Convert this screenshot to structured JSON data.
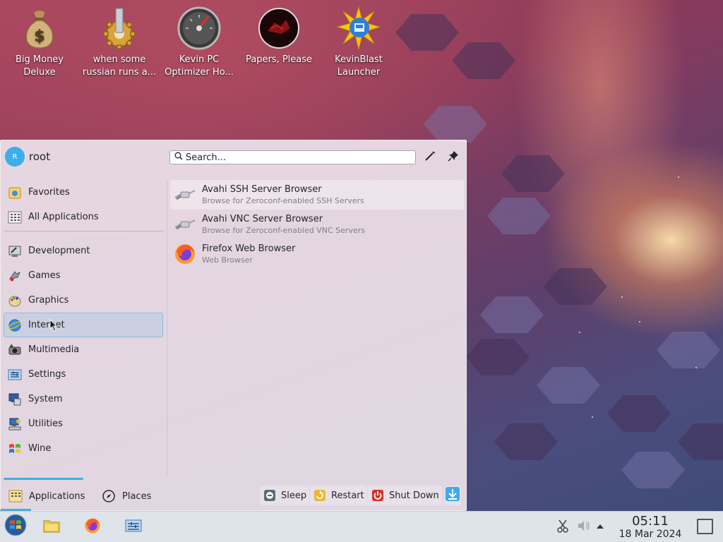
{
  "desktop": {
    "icons": [
      {
        "label": "Big Money Deluxe",
        "line1": "Big Money",
        "line2": "Deluxe",
        "icon": "money-bag-icon"
      },
      {
        "label": "when some russian runs a...",
        "line1": "when some",
        "line2": "russian runs a...",
        "icon": "gear-icon"
      },
      {
        "label": "Kevin PC Optimizer Ho...",
        "line1": "Kevin PC",
        "line2": "Optimizer Ho...",
        "icon": "speedometer-icon"
      },
      {
        "label": "Papers, Please",
        "line1": "Papers, Please",
        "line2": "",
        "icon": "papers-please-icon"
      },
      {
        "label": "KevinBlast Launcher",
        "line1": "KevinBlast",
        "line2": "Launcher",
        "icon": "kevinblast-icon"
      }
    ]
  },
  "launcher": {
    "user": {
      "initial": "R",
      "name": "root"
    },
    "search": {
      "placeholder": "Search..."
    },
    "sidebar": {
      "top": [
        {
          "label": "Favorites",
          "icon": "favorites-icon"
        },
        {
          "label": "All Applications",
          "icon": "all-apps-icon"
        }
      ],
      "categories": [
        {
          "label": "Development",
          "icon": "development-icon"
        },
        {
          "label": "Games",
          "icon": "games-icon"
        },
        {
          "label": "Graphics",
          "icon": "graphics-icon"
        },
        {
          "label": "Internet",
          "icon": "internet-icon",
          "selected": true
        },
        {
          "label": "Multimedia",
          "icon": "multimedia-icon"
        },
        {
          "label": "Settings",
          "icon": "settings-icon"
        },
        {
          "label": "System",
          "icon": "system-icon"
        },
        {
          "label": "Utilities",
          "icon": "utilities-icon"
        },
        {
          "label": "Wine",
          "icon": "wine-icon"
        }
      ]
    },
    "apps": [
      {
        "name": "Avahi SSH Server Browser",
        "desc": "Browse for Zeroconf-enabled SSH Servers",
        "icon": "network-plug-icon"
      },
      {
        "name": "Avahi VNC Server Browser",
        "desc": "Browse for Zeroconf-enabled VNC Servers",
        "icon": "network-plug-icon"
      },
      {
        "name": "Firefox Web Browser",
        "desc": "Web Browser",
        "icon": "firefox-icon"
      }
    ],
    "tabs": {
      "applications": "Applications",
      "places": "Places"
    },
    "power": {
      "sleep": "Sleep",
      "restart": "Restart",
      "shutdown": "Shut Down"
    }
  },
  "taskbar": {
    "time": "05:11",
    "date": "18 Mar 2024"
  },
  "colors": {
    "accent": "#3daee9"
  }
}
